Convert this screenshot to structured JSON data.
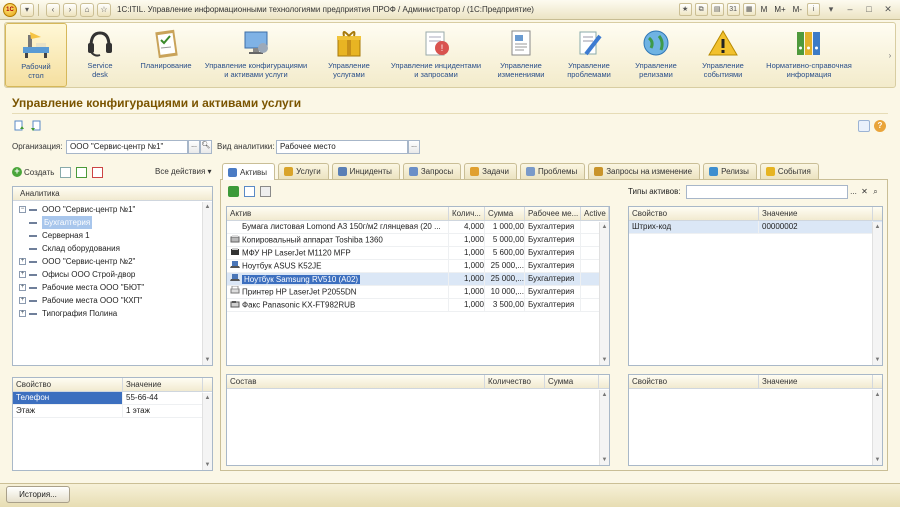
{
  "window": {
    "title": "1C:ITIL. Управление информационными технологиями предприятия ПРОФ / Администратор / (1С:Предприятие)",
    "logo_text": "1С",
    "right_texts": [
      "M",
      "M+",
      "M-"
    ]
  },
  "sections": [
    {
      "label": "Рабочий\nстол",
      "icon": "desk-icon"
    },
    {
      "label": "Service\ndesk",
      "icon": "headset-icon"
    },
    {
      "label": "Планирование",
      "icon": "clipboard-icon"
    },
    {
      "label": "Управление конфигурациями\nи активами услуги",
      "icon": "monitor-icon"
    },
    {
      "label": "Управление\nуслугами",
      "icon": "gift-icon"
    },
    {
      "label": "Управление инцидентами\nи запросами",
      "icon": "incident-icon"
    },
    {
      "label": "Управление\nизменениями",
      "icon": "document-icon"
    },
    {
      "label": "Управление\nпроблемами",
      "icon": "pen-icon"
    },
    {
      "label": "Управление\nрелизами",
      "icon": "globe-icon"
    },
    {
      "label": "Управление\nсобытиями",
      "icon": "warning-icon"
    },
    {
      "label": "Нормативно-справочная\nинформация",
      "icon": "binders-icon"
    }
  ],
  "page": {
    "title": "Управление конфигурациями и активами услуги"
  },
  "filters": {
    "org_label": "Организация:",
    "org_value": "ООО \"Сервис-центр №1\"",
    "view_label": "Вид аналитики:",
    "view_value": "Рабочее место"
  },
  "left_toolbar": {
    "create": "Создать",
    "all_actions": "Все действия ▾"
  },
  "analytics": {
    "header": "Аналитика",
    "rows": [
      {
        "text": "ООО \"Сервис-центр №1\"",
        "level": 0,
        "exp": "−"
      },
      {
        "text": "Бухгалтерия",
        "level": 1,
        "selected": true
      },
      {
        "text": "Серверная 1",
        "level": 1
      },
      {
        "text": "Склад оборудования",
        "level": 1
      },
      {
        "text": "ООО \"Сервис-центр №2\"",
        "level": 0,
        "exp": "+"
      },
      {
        "text": "Офисы ООО Строй-двор",
        "level": 0,
        "exp": "+"
      },
      {
        "text": "Рабочие места ООО \"БЮТ\"",
        "level": 0,
        "exp": "+"
      },
      {
        "text": "Рабочие места ООО \"КХП\"",
        "level": 0,
        "exp": "+"
      },
      {
        "text": "Типография Полина",
        "level": 0,
        "exp": "+"
      }
    ]
  },
  "props_left": {
    "headers": [
      "Свойство",
      "Значение"
    ],
    "rows": [
      [
        "Телефон",
        "55-66-44"
      ],
      [
        "Этаж",
        "1 этаж"
      ]
    ]
  },
  "tabs": [
    "Активы",
    "Услуги",
    "Инциденты",
    "Запросы",
    "Задачи",
    "Проблемы",
    "Запросы на изменение",
    "Релизы",
    "События"
  ],
  "tab_icon_colors": [
    "#4a7bc4",
    "#d9a42a",
    "#5a7fb5",
    "#6b8fc7",
    "#e0a030",
    "#7a9ac9",
    "#c9942a",
    "#3f8fcf",
    "#e6b422"
  ],
  "assets": {
    "headers": [
      "Актив",
      "Колич...",
      "Сумма",
      "Рабочее ме...",
      "Active"
    ],
    "rows": [
      {
        "name": "Бумага листовая Lomond A3 150г/м2 глянцевая (20 ...",
        "qty": "4,000",
        "sum": "1 000,00",
        "place": "Бухгалтерия",
        "icon": "none"
      },
      {
        "name": "Копировальный аппарат Toshiba 1360",
        "qty": "1,000",
        "sum": "5 000,00",
        "place": "Бухгалтерия",
        "icon": "copier"
      },
      {
        "name": "МФУ HP LaserJet M1120 MFP",
        "qty": "1,000",
        "sum": "5 600,00",
        "place": "Бухгалтерия",
        "icon": "mfp"
      },
      {
        "name": "Ноутбук ASUS K52JE",
        "qty": "1,000",
        "sum": "25 000,...",
        "place": "Бухгалтерия",
        "icon": "laptop"
      },
      {
        "name": "Ноутбук Samsung RV510 (A02)",
        "qty": "1,000",
        "sum": "25 000,...",
        "place": "Бухгалтерия",
        "icon": "laptop",
        "selected": true
      },
      {
        "name": "Принтер HP LaserJet P2055DN",
        "qty": "1,000",
        "sum": "10 000,...",
        "place": "Бухгалтерия",
        "icon": "printer"
      },
      {
        "name": "Факс Panasonic KX-FT982RUB",
        "qty": "1,000",
        "sum": "3 500,00",
        "place": "Бухгалтерия",
        "icon": "fax"
      }
    ]
  },
  "types": {
    "label": "Типы активов:",
    "value": ""
  },
  "props_right": {
    "headers": [
      "Свойство",
      "Значение"
    ],
    "rows": [
      [
        "Штрих-код",
        "00000002"
      ]
    ]
  },
  "composition": {
    "headers": [
      "Состав",
      "Количество",
      "Сумма"
    ]
  },
  "props_right2": {
    "headers": [
      "Свойство",
      "Значение"
    ]
  },
  "history_button": "История..."
}
